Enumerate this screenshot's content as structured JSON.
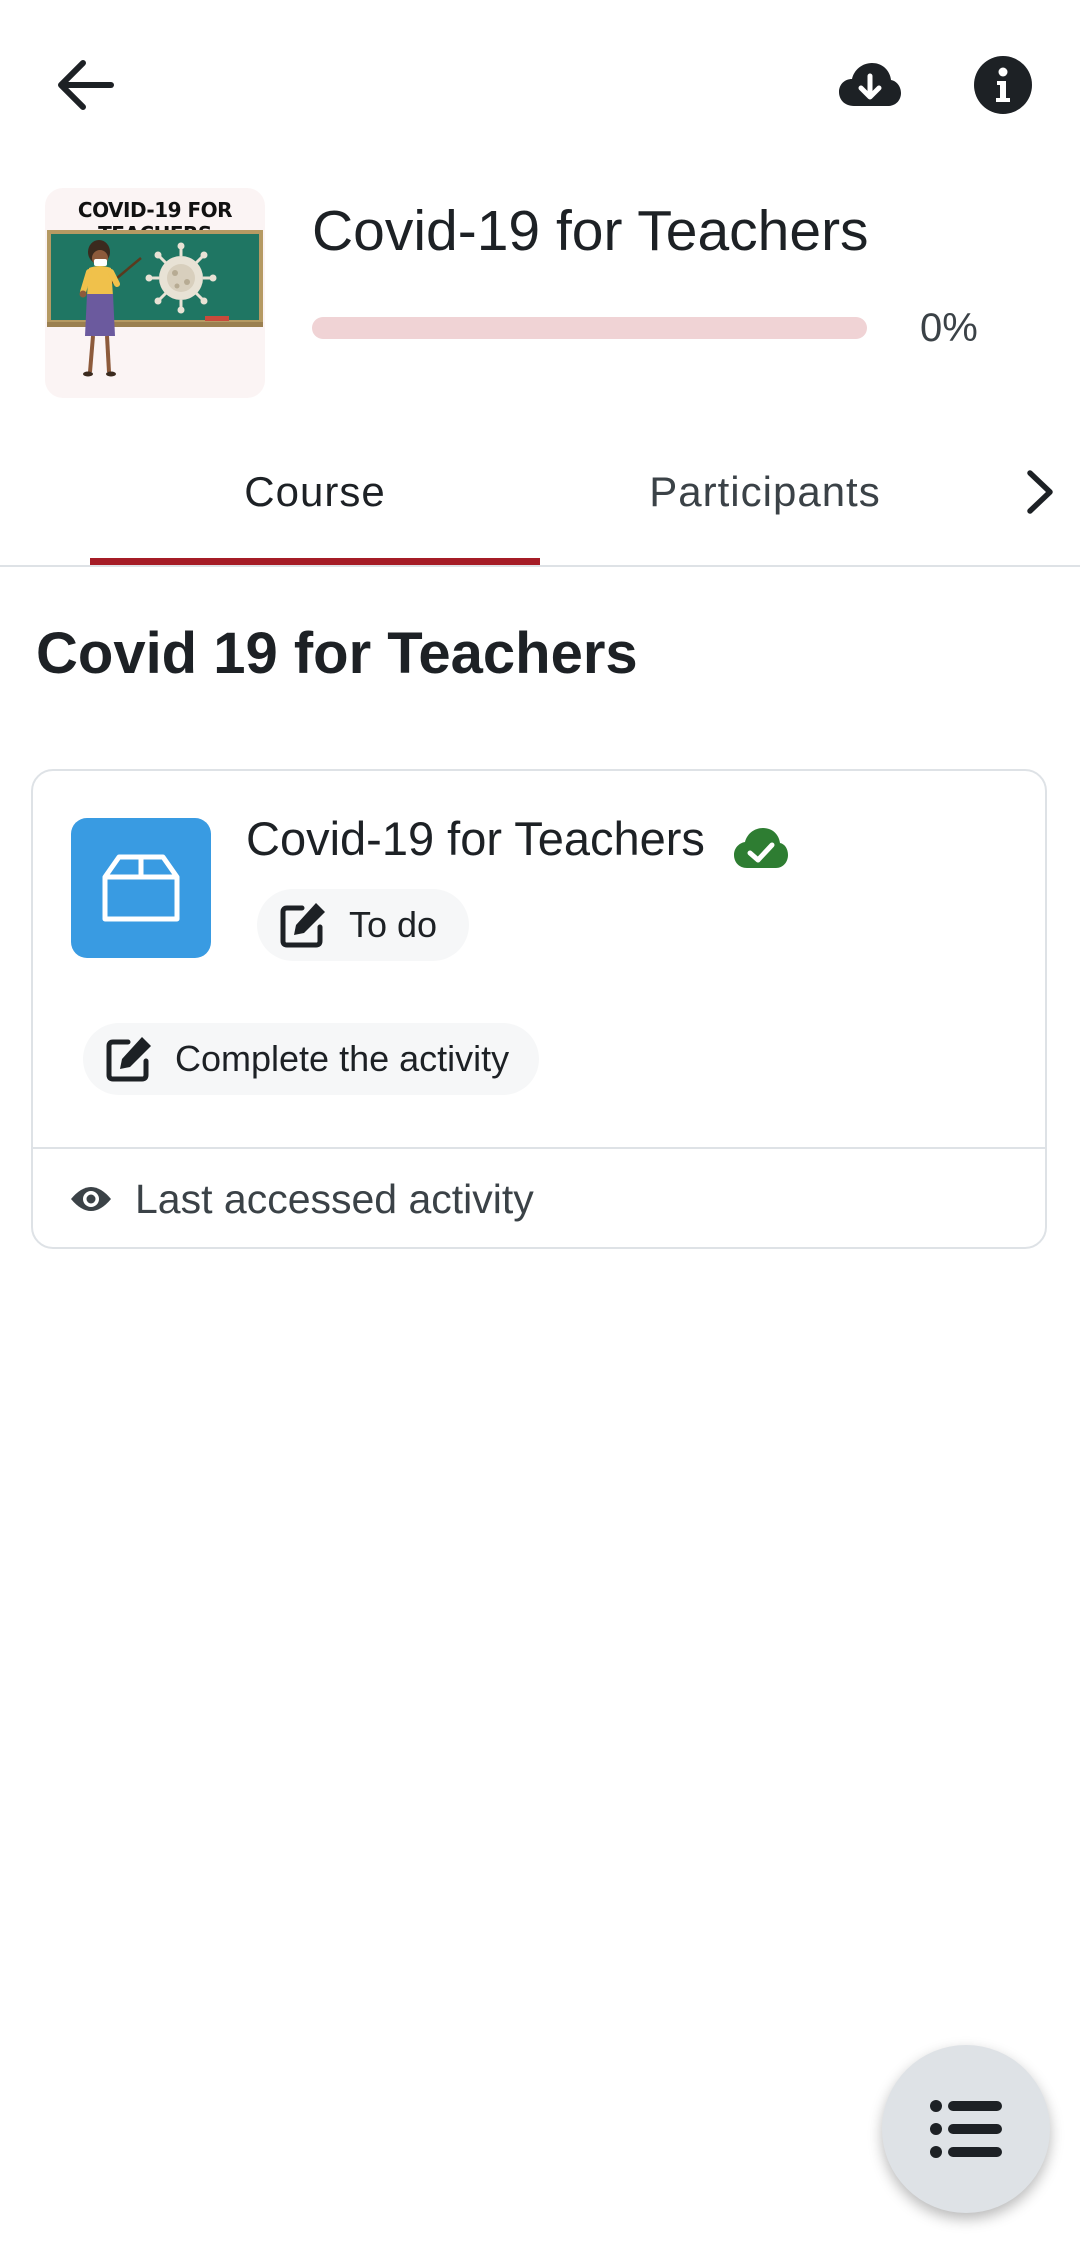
{
  "toolbar": {
    "back_icon": "arrow-left-icon",
    "download_icon": "cloud-download-icon",
    "info_icon": "info-circle-icon"
  },
  "course": {
    "image_caption": "COVID-19 FOR TEACHERS",
    "title": "Covid-19 for Teachers",
    "progress_percent": 0,
    "progress_label": "0%",
    "progress_color": "#a51c26"
  },
  "tabs": {
    "items": [
      {
        "label": "Course",
        "active": true
      },
      {
        "label": "Participants",
        "active": false
      }
    ],
    "next_icon": "chevron-right-icon",
    "active_color": "#a51c26"
  },
  "section": {
    "title": "Covid 19 for Teachers"
  },
  "activity": {
    "name": "Covid-19 for Teachers",
    "icon": "package-icon",
    "icon_bg": "#399be2",
    "status_icon": "cloud-done-icon",
    "status_color": "#2e7d32",
    "todo_label": "To do",
    "completion_label": "Complete the activity",
    "last_accessed_label": "Last accessed activity"
  },
  "fab": {
    "icon": "list-icon"
  }
}
